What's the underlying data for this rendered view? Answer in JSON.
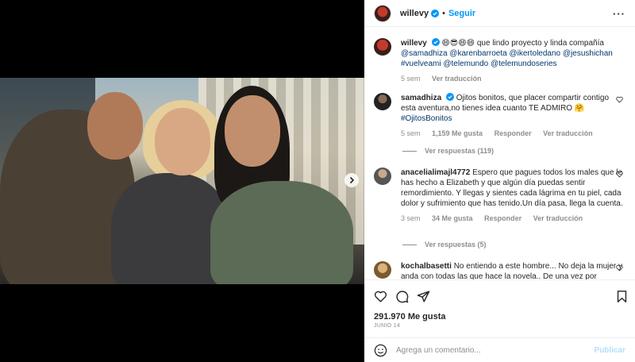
{
  "post": {
    "username": "willevy",
    "follow_label": "Seguir",
    "dot": "•",
    "more": "···"
  },
  "caption": {
    "username": "willevy",
    "text_before": " 😄😎😄😄 que lindo proyecto y linda compañía ",
    "mentions": "@samadhiza @karenbarroeta @ikertoledano @jesushichan #vuelveami @telemundo @telemundoseries",
    "time": "5 sem",
    "translate": "Ver traducción"
  },
  "comments": [
    {
      "username": "samadhiza",
      "text": " Ojitos bonitos, que placer compartir contigo esta aventura,no tienes idea cuanto TE ADMIRO 🤗 ",
      "hashtag": "#OjitosBonitos",
      "time": "5 sem",
      "likes": "1,159 Me gusta",
      "reply": "Responder",
      "translate": "Ver traducción",
      "replies": "Ver respuestas (119)"
    },
    {
      "username": "anacelialimajl4772",
      "text": " Espero que pagues todos los males que le has hecho a Elizabeth y que algún día puedas sentir remordimiento. Y llegas y sientes cada lágrima en tu piel, cada dolor y sufrimiento que has tenido.Un día pasa, llega la cuenta.",
      "time": "3 sem",
      "likes": "34 Me gusta",
      "reply": "Responder",
      "translate": "Ver traducción",
      "replies": "Ver respuestas (5)"
    },
    {
      "username": "kochalbasetti",
      "text": " No entiendo a este hombre... No deja la mujer y anda con todas las que hace la novela.. De una vez por"
    }
  ],
  "footer": {
    "likes": "291.970 Me gusta",
    "date": "JUNIO 14",
    "comment_placeholder": "Agrega un comentario...",
    "post_label": "Publicar"
  },
  "colors": {
    "accent": "#0095f6",
    "link": "#00376b",
    "muted": "#8e8e8e",
    "text": "#262626"
  },
  "icons": [
    "chevron-right-icon",
    "verified-badge-icon",
    "heart-icon",
    "comment-icon",
    "share-icon",
    "bookmark-icon",
    "emoji-icon"
  ]
}
